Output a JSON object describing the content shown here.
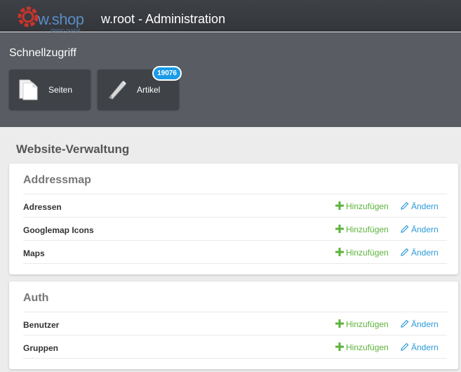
{
  "header": {
    "logo_text": "w.shop",
    "logo_sub": "demo portal",
    "title": "w.root - Administration"
  },
  "quick_access": {
    "title": "Schnellzugriff",
    "tiles": [
      {
        "label": "Seiten",
        "icon": "pages-icon"
      },
      {
        "label": "Artikel",
        "icon": "pencil-icon",
        "badge": "19076"
      }
    ]
  },
  "main": {
    "section_title": "Website-Verwaltung",
    "panels": [
      {
        "title": "Addressmap",
        "rows": [
          {
            "label": "Adressen",
            "add": "Hinzufügen",
            "edit": "Ändern"
          },
          {
            "label": "Googlemap Icons",
            "add": "Hinzufügen",
            "edit": "Ändern"
          },
          {
            "label": "Maps",
            "add": "Hinzufügen",
            "edit": "Ändern"
          }
        ]
      },
      {
        "title": "Auth",
        "rows": [
          {
            "label": "Benutzer",
            "add": "Hinzufügen",
            "edit": "Ändern"
          },
          {
            "label": "Gruppen",
            "add": "Hinzufügen",
            "edit": "Ändern"
          }
        ]
      }
    ]
  },
  "colors": {
    "header_bg": "#3b3e43",
    "quick_bg": "#595c62",
    "add_green": "#5cb33a",
    "edit_blue": "#2b9ad8",
    "badge_blue": "#1a9be6"
  }
}
